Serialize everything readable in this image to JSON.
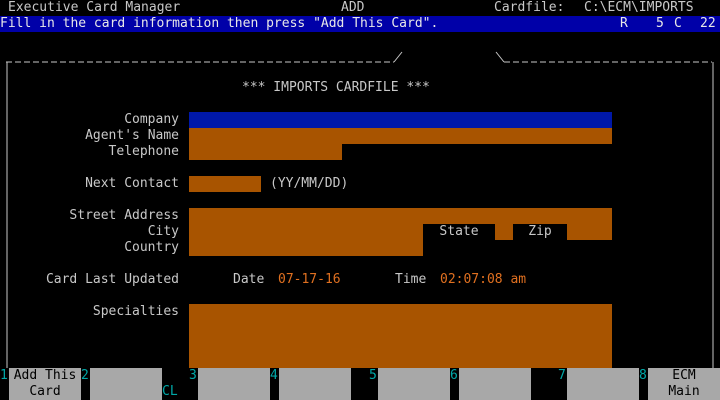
{
  "header": {
    "app_title": "Executive Card Manager",
    "mode": "ADD",
    "cardfile_label": "Cardfile:",
    "cardfile_path": "C:\\ECM\\IMPORTS"
  },
  "status": {
    "message": "Fill in the card information then press \"Add This Card\".",
    "row_label": "R",
    "row_value": "5",
    "col_label": "C",
    "col_value": "22"
  },
  "card": {
    "title": "*** IMPORTS CARDFILE ***"
  },
  "labels": {
    "company": "Company",
    "agent_name": "Agent's Name",
    "telephone": "Telephone",
    "next_contact": "Next Contact",
    "date_format": "(YY/MM/DD)",
    "street_address": "Street Address",
    "city": "City",
    "country": "Country",
    "state": "State",
    "zip": "Zip",
    "card_last_updated": "Card Last Updated",
    "date_label": "Date",
    "time_label": "Time",
    "specialties": "Specialties"
  },
  "values": {
    "company": "",
    "agent_name": "",
    "telephone": "",
    "next_contact": "",
    "street_address": "",
    "city": "",
    "country": "",
    "state": "",
    "zip": "",
    "date": "07-17-16",
    "time": "02:07:08 am",
    "specialties": ""
  },
  "function_keys": [
    {
      "num": "1",
      "label": "Add This\nCard"
    },
    {
      "num": "2",
      "label": "",
      "suffix": "CL"
    },
    {
      "num": "3",
      "label": ""
    },
    {
      "num": "4",
      "label": ""
    },
    {
      "num": "5",
      "label": ""
    },
    {
      "num": "6",
      "label": ""
    },
    {
      "num": "7",
      "label": ""
    },
    {
      "num": "8",
      "label": "ECM\nMain"
    }
  ]
}
